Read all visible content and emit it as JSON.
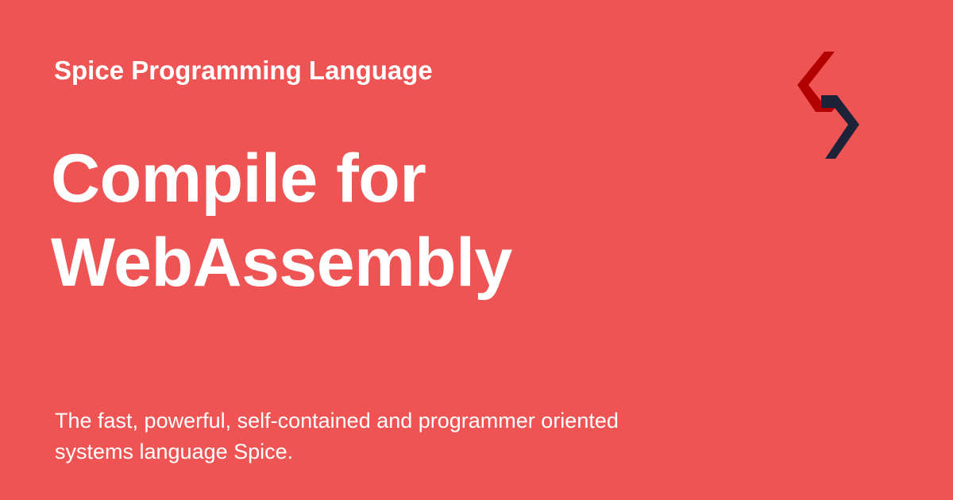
{
  "site_name": "Spice Programming Language",
  "title": {
    "line1": "Compile for",
    "line2": "WebAssembly"
  },
  "description": "The fast, powerful, self-contained and programmer oriented systems language Spice.",
  "logo": {
    "icon": "spice-logo-icon",
    "colors": {
      "upper": "#b20000",
      "lower": "#1c2238"
    }
  },
  "colors": {
    "background": "#ef5454",
    "text": "#ffffff"
  }
}
